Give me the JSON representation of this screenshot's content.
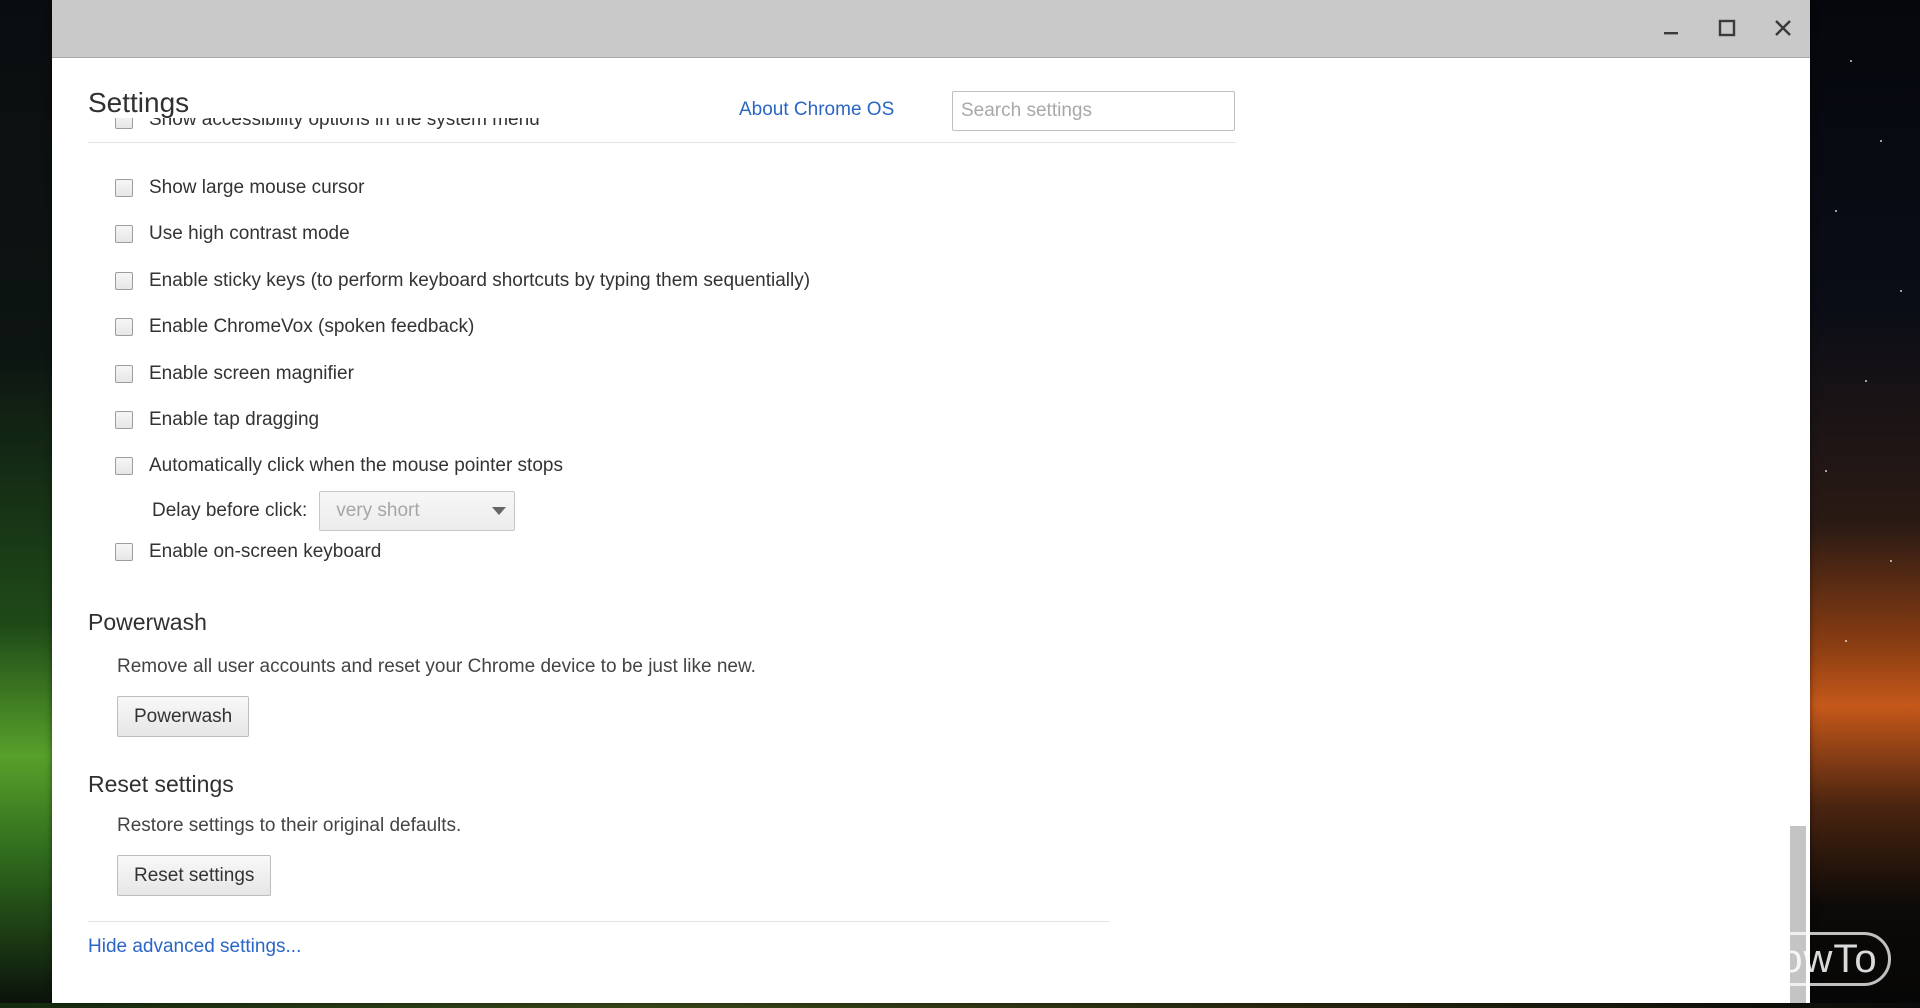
{
  "window": {
    "controls": {
      "minimize_icon": "minimize-icon",
      "maximize_icon": "maximize-icon",
      "close_icon": "close-icon"
    }
  },
  "header": {
    "title": "Settings",
    "about_link": "About Chrome OS",
    "search_placeholder": "Search settings",
    "search_value": ""
  },
  "accessibility": {
    "clipped_item": "Show accessibility options in the system menu",
    "items": [
      {
        "label": "Show large mouse cursor",
        "checked": false
      },
      {
        "label": "Use high contrast mode",
        "checked": false
      },
      {
        "label": "Enable sticky keys (to perform keyboard shortcuts by typing them sequentially)",
        "checked": false
      },
      {
        "label": "Enable ChromeVox (spoken feedback)",
        "checked": false
      },
      {
        "label": "Enable screen magnifier",
        "checked": false
      },
      {
        "label": "Enable tap dragging",
        "checked": false
      },
      {
        "label": "Automatically click when the mouse pointer stops",
        "checked": false
      }
    ],
    "delay": {
      "label": "Delay before click:",
      "selected": "very short"
    },
    "onscreen_keyboard": {
      "label": "Enable on-screen keyboard",
      "checked": false
    }
  },
  "powerwash": {
    "title": "Powerwash",
    "description": "Remove all user accounts and reset your Chrome device to be just like new.",
    "button": "Powerwash"
  },
  "reset": {
    "title": "Reset settings",
    "description": "Restore settings to their original defaults.",
    "button": "Reset settings"
  },
  "footer": {
    "hide_link": "Hide advanced settings..."
  },
  "watermark": "HowTo",
  "colors": {
    "link": "#2a66c6",
    "titlebar": "#c9c9c9",
    "text": "#333333"
  }
}
